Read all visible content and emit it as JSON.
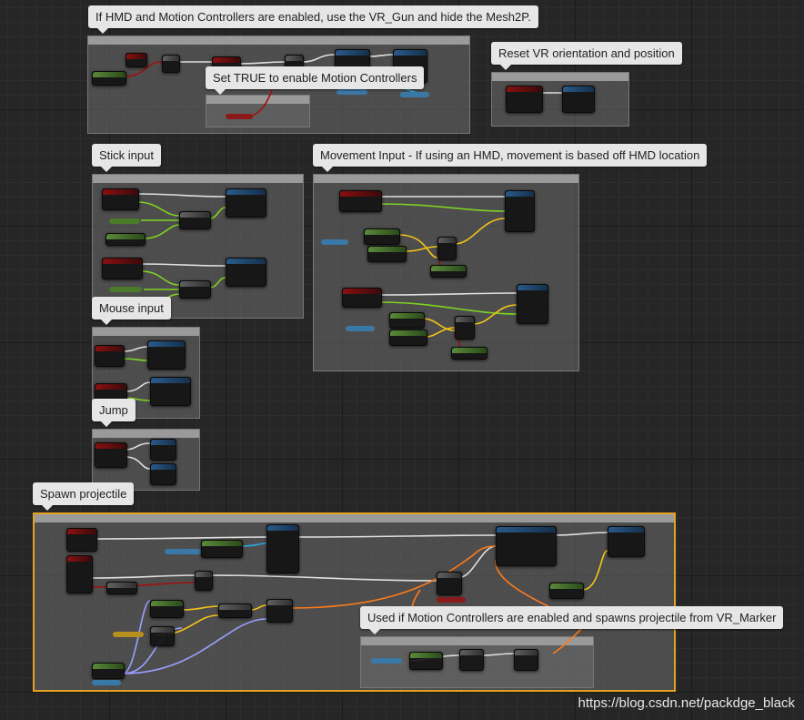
{
  "comments": [
    {
      "id": "hmd",
      "bubble": "If HMD and Motion Controllers are enabled, use the VR_Gun and hide the Mesh2P."
    },
    {
      "id": "set_true",
      "bubble": "Set TRUE to enable Motion Controllers"
    },
    {
      "id": "reset_vr",
      "bubble": "Reset VR orientation and position"
    },
    {
      "id": "stick",
      "bubble": "Stick input"
    },
    {
      "id": "movement",
      "bubble": "Movement Input - If using an HMD, movement is based off HMD location"
    },
    {
      "id": "mouse",
      "bubble": "Mouse input"
    },
    {
      "id": "jump",
      "bubble": "Jump"
    },
    {
      "id": "spawn",
      "bubble": "Spawn projectile"
    },
    {
      "id": "vr_marker",
      "bubble": "Used if Motion Controllers are enabled and spawns projectile from VR_Marker"
    }
  ],
  "watermark": "https://blog.csdn.net/packdge_black",
  "colors": {
    "exec": "#e0e0e0",
    "bool": "#a01010",
    "float": "#7ed321",
    "vector": "#f5c518",
    "object": "#2aa6e0",
    "rotator": "#9aa0ff",
    "transform": "#ff7b1a"
  }
}
